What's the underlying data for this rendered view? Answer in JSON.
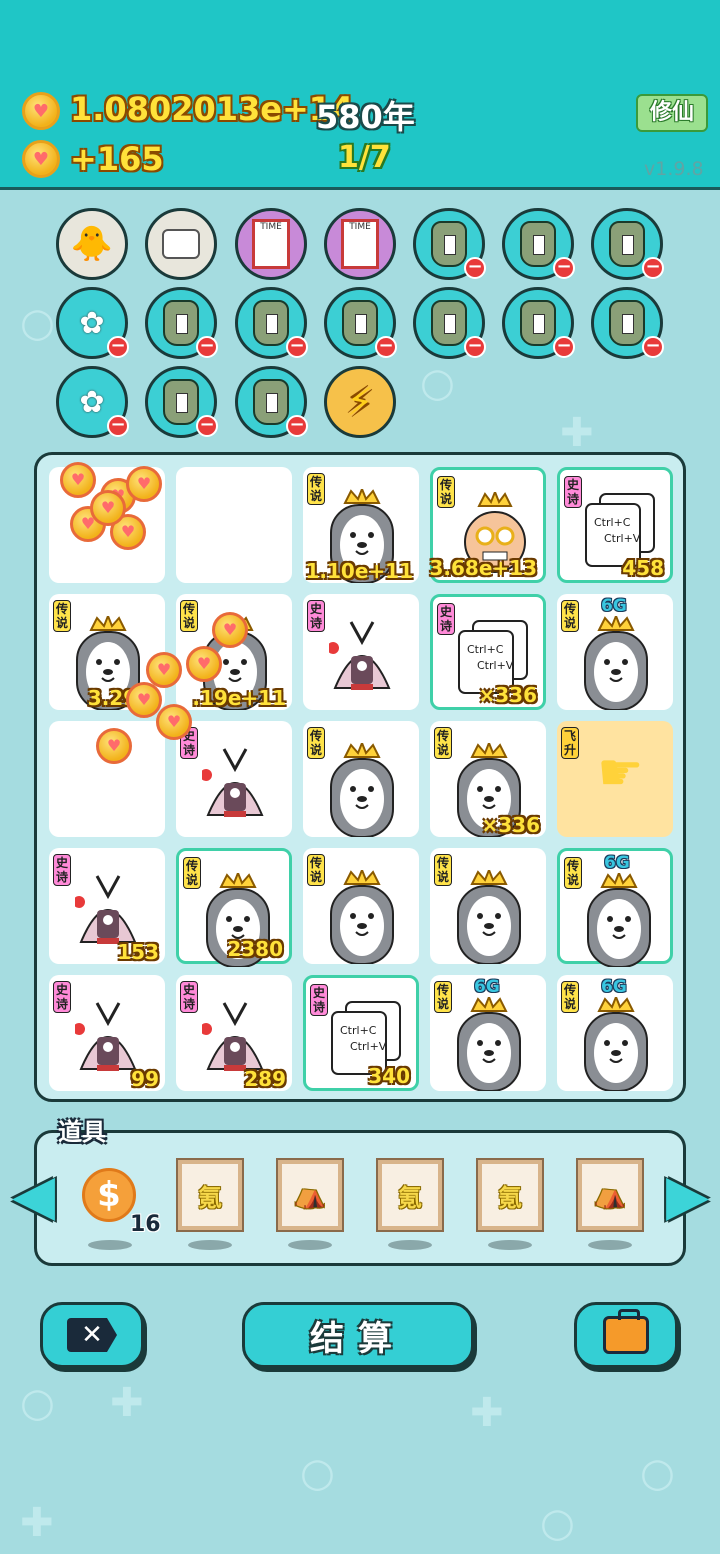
{
  "header": {
    "money": "1.0802013e+14",
    "year": "580年",
    "income": "+165",
    "page": "1/7",
    "xiuxian_label": "修仙",
    "version": "v1.9.8"
  },
  "board": {
    "cells": [
      {
        "tag": "",
        "count": ""
      },
      {
        "tag": "",
        "count": ""
      },
      {
        "tag": "传说",
        "count": "1.10e+11"
      },
      {
        "tag": "传说",
        "count": "3.68e+13"
      },
      {
        "tag": "史诗",
        "count": "458"
      },
      {
        "tag": "传说",
        "count": "3.29e-"
      },
      {
        "tag": "传说",
        "count": ".19e+11"
      },
      {
        "tag": "史诗",
        "count": ""
      },
      {
        "tag": "史诗",
        "count": "×336"
      },
      {
        "tag": "传说",
        "count": "",
        "badge": "6G"
      },
      {
        "tag": "",
        "count": ""
      },
      {
        "tag": "史诗",
        "count": ""
      },
      {
        "tag": "传说",
        "count": ""
      },
      {
        "tag": "传说",
        "count": "×336"
      },
      {
        "tag": "飞升",
        "count": ""
      },
      {
        "tag": "史诗",
        "count": "153"
      },
      {
        "tag": "传说",
        "count": "2380"
      },
      {
        "tag": "传说",
        "count": ""
      },
      {
        "tag": "传说",
        "count": ""
      },
      {
        "tag": "传说",
        "count": "",
        "badge": "6G"
      },
      {
        "tag": "史诗",
        "count": "99"
      },
      {
        "tag": "史诗",
        "count": "289"
      },
      {
        "tag": "史诗",
        "count": "340"
      },
      {
        "tag": "传说",
        "count": "",
        "badge": "6G"
      },
      {
        "tag": "传说",
        "count": "",
        "badge": "6G"
      }
    ],
    "copy_text_1": "Ctrl+C",
    "copy_text_2": "Ctrl+V"
  },
  "props": {
    "label": "道具",
    "coin_count": "16",
    "frame_char": "氪"
  },
  "buttons": {
    "settle_label": "结算"
  },
  "colors": {
    "header_bg": "#1fc6c6",
    "page_bg": "#a5dce0",
    "accent_yellow": "#ffe23a"
  }
}
